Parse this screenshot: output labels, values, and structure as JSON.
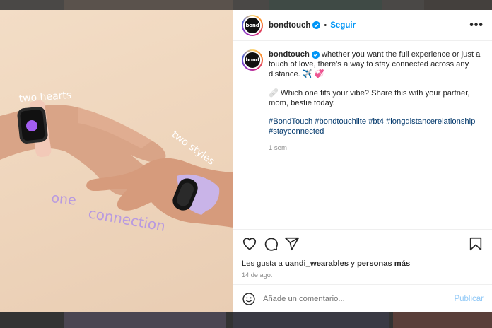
{
  "post": {
    "username": "bondtouch",
    "avatar_text": "bond",
    "follow_label": "Seguir",
    "more_label": "•••",
    "image_texts": {
      "two_hearts": "two hearts",
      "two_styles": "two styles",
      "one": "one",
      "connection": "connection"
    },
    "caption": {
      "text": " whether you want the full experience or just a touch of love, there's a way to stay connected across any distance. ✈️ 💞",
      "line2": "🩹 Which one fits your vibe? Share this with your partner, mom, bestie today.",
      "hashtags": "#BondTouch #bondtouchlite #bt4 #longdistancerelationship #stayconnected",
      "age": "1 sem"
    },
    "likes": {
      "prefix": "Les gusta a ",
      "user": "uandi_wearables",
      "middle": " y ",
      "others": "personas más"
    },
    "date": "14 de ago.",
    "comment": {
      "placeholder": "Añade un comentario...",
      "publish_label": "Publicar"
    }
  },
  "icons": {
    "like": "heart-icon",
    "comment": "comment-icon",
    "share": "share-icon",
    "save": "bookmark-icon",
    "emoji": "emoji-icon",
    "verified": "verified-badge-icon",
    "more": "more-options-icon"
  },
  "colors": {
    "accent": "#0095f6",
    "hashtag": "#00376b",
    "verified": "#0095f6",
    "image_text": "#ffffff",
    "image_text_purple": "#b89ae0"
  }
}
